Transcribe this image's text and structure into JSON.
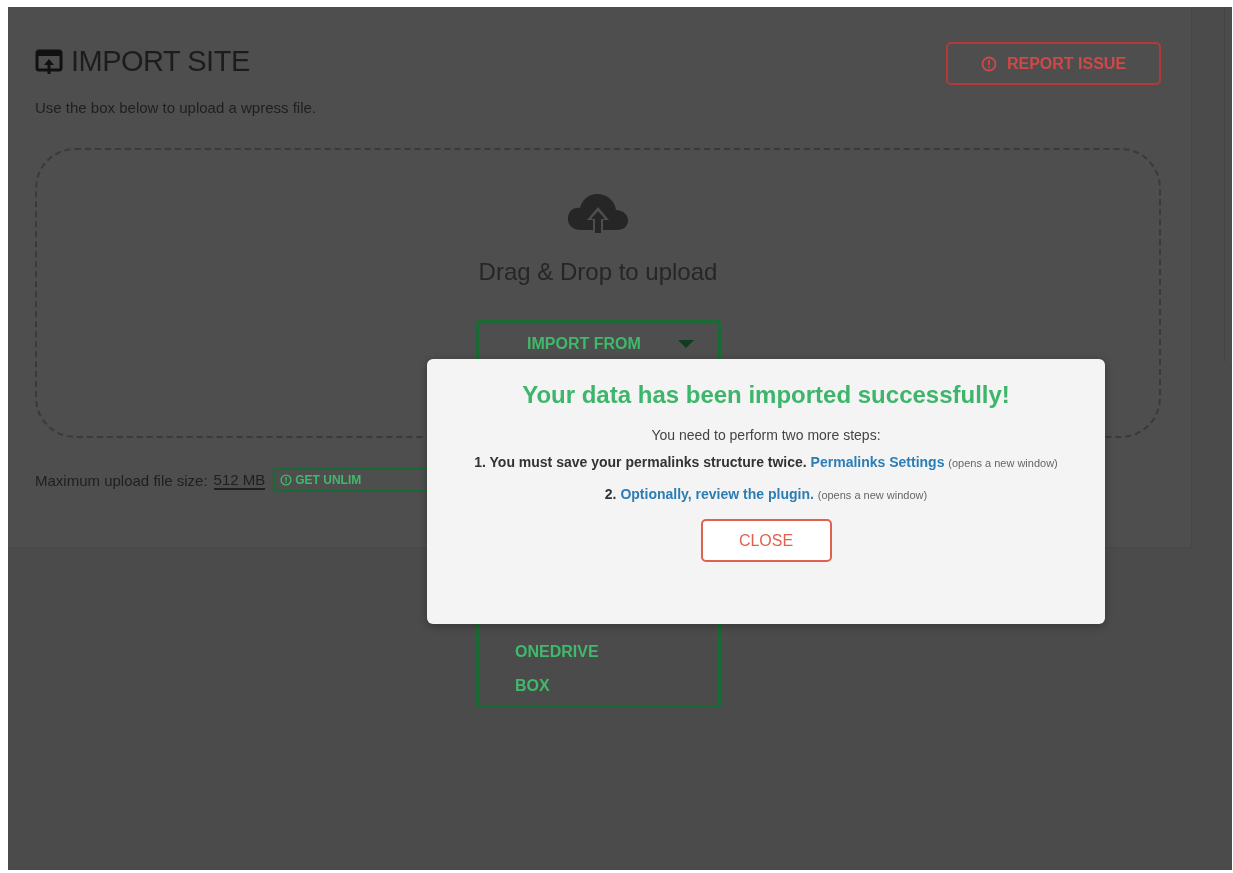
{
  "page": {
    "title": "IMPORT SITE",
    "report_button": "REPORT ISSUE",
    "description": "Use the box below to upload a wpress file.",
    "dropzone": {
      "text": "Drag & Drop to upload"
    },
    "import_menu": {
      "label": "IMPORT FROM",
      "expanded": true,
      "items": [
        "ONEDRIVE",
        "BOX"
      ]
    },
    "max_size": {
      "label": "Maximum upload file size:",
      "value": "512 MB",
      "upgrade_button": "GET UNLIM"
    }
  },
  "modal": {
    "title": "Your data has been imported successfully!",
    "intro": "You need to perform two more steps:",
    "steps": [
      {
        "number": "1.",
        "text": "You must save your permalinks structure twice.",
        "link": "Permalinks Settings",
        "note": "(opens a new window)"
      },
      {
        "number": "2.",
        "link": "Optionally, review the plugin.",
        "note": "(opens a new window)"
      }
    ],
    "close_button": "CLOSE"
  }
}
